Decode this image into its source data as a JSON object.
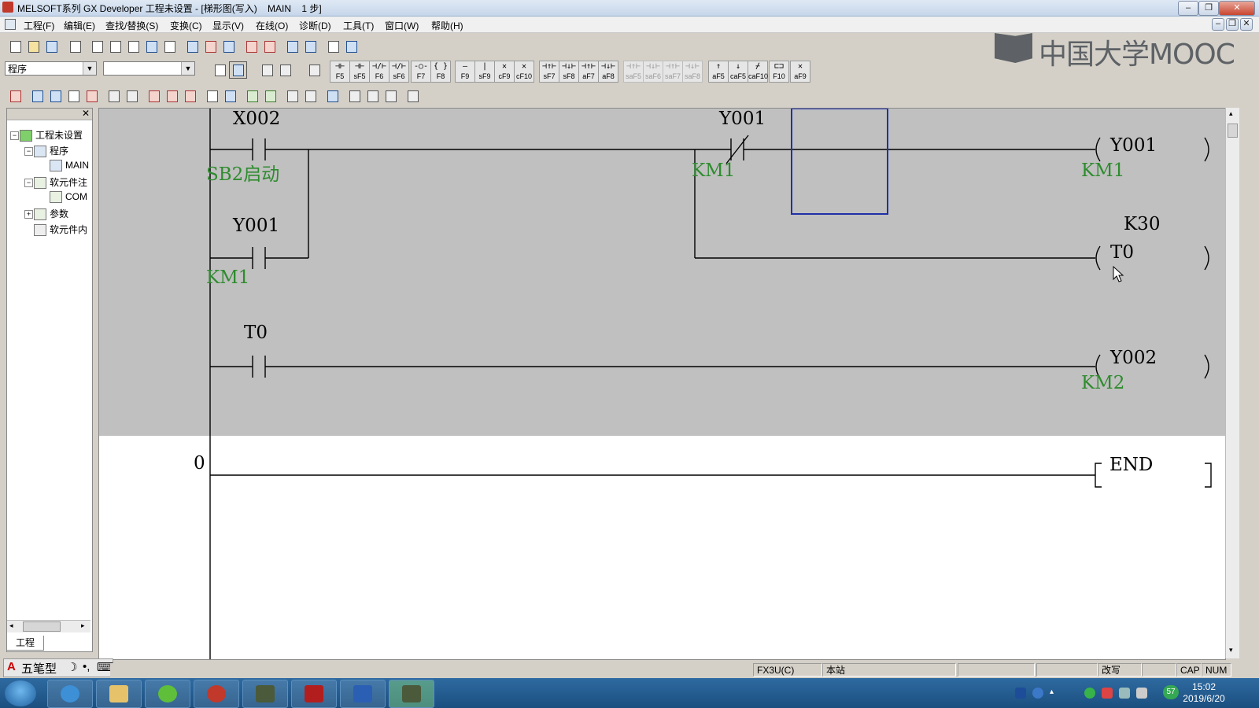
{
  "window": {
    "title": "MELSOFT系列 GX Developer 工程未设置 - [梯形图(写入)    MAIN    1 步]"
  },
  "menu": [
    "工程(F)",
    "编辑(E)",
    "查找/替换(S)",
    "变换(C)",
    "显示(V)",
    "在线(O)",
    "诊断(D)",
    "工具(T)",
    "窗口(W)",
    "帮助(H)"
  ],
  "toolbar": {
    "program_select": "程序",
    "device_select": "",
    "fkeys": [
      {
        "sym": "⊣⊢",
        "label": "F5",
        "dim": false
      },
      {
        "sym": "⊣⊢",
        "label": "sF5",
        "dim": false
      },
      {
        "sym": "⊣/⊢",
        "label": "F6",
        "dim": false
      },
      {
        "sym": "⊣/⊢",
        "label": "sF6",
        "dim": false
      },
      {
        "sym": "-○-",
        "label": "F7",
        "dim": false
      },
      {
        "sym": "{ }",
        "label": "F8",
        "dim": false
      },
      {
        "sym": "—",
        "label": "F9",
        "dim": false
      },
      {
        "sym": "|",
        "label": "sF9",
        "dim": false
      },
      {
        "sym": "✕",
        "label": "cF9",
        "dim": false
      },
      {
        "sym": "✕",
        "label": "cF10",
        "dim": false
      },
      {
        "sym": "⊣↑⊢",
        "label": "sF7",
        "dim": false
      },
      {
        "sym": "⊣↓⊢",
        "label": "sF8",
        "dim": false
      },
      {
        "sym": "⊣↑⊢",
        "label": "aF7",
        "dim": false
      },
      {
        "sym": "⊣↓⊢",
        "label": "aF8",
        "dim": false
      },
      {
        "sym": "⊣↑⊢",
        "label": "saF5",
        "dim": true
      },
      {
        "sym": "⊣↓⊢",
        "label": "saF6",
        "dim": true
      },
      {
        "sym": "⊣↑⊢",
        "label": "saF7",
        "dim": true
      },
      {
        "sym": "⊣↓⊢",
        "label": "saF8",
        "dim": true
      },
      {
        "sym": "↑",
        "label": "aF5",
        "dim": false
      },
      {
        "sym": "↓",
        "label": "caF5",
        "dim": false
      },
      {
        "sym": "⌿",
        "label": "caF10",
        "dim": false
      },
      {
        "sym": "⊏⊐",
        "label": "F10",
        "dim": false
      },
      {
        "sym": "✕",
        "label": "aF9",
        "dim": false
      }
    ]
  },
  "watermark": {
    "text": "中国大学MOOC"
  },
  "project_tree": {
    "root": "工程未设置",
    "items": [
      "程序",
      "MAIN",
      "软元件注",
      "COM",
      "参数",
      "软元件内"
    ],
    "tab": "工程"
  },
  "ladder": {
    "rungs": [
      {
        "step": "",
        "contacts": [
          {
            "device": "X002",
            "comment": "SB2启动",
            "type": "NO"
          },
          {
            "device": "Y001",
            "comment": "KM1",
            "type": "NO"
          },
          {
            "device": "Y001",
            "comment": "KM1",
            "type": "NC"
          }
        ],
        "coils": [
          {
            "device": "Y001",
            "comment": "KM1"
          },
          {
            "device": "T0",
            "comment": "",
            "setting": "K30"
          }
        ]
      },
      {
        "step": "",
        "contacts": [
          {
            "device": "T0",
            "comment": "",
            "type": "NO"
          }
        ],
        "coils": [
          {
            "device": "Y002",
            "comment": "KM2"
          }
        ]
      },
      {
        "step": "0",
        "end": "END"
      }
    ]
  },
  "ime": {
    "label": "五笔型"
  },
  "status": {
    "plc": "FX3U(C)",
    "station": "本站",
    "mode": "改写",
    "cap": "CAP",
    "num": "NUM"
  },
  "taskbar": {
    "clock_time": "15:02",
    "clock_date": "2019/6/20",
    "badge": "57"
  }
}
